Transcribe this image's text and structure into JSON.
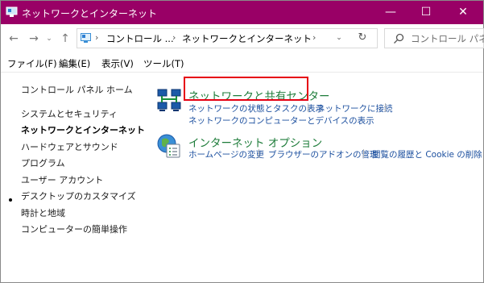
{
  "window": {
    "title": "ネットワークとインターネット",
    "buttons": {
      "minimize": "—",
      "maximize": "☐",
      "close": "✕"
    }
  },
  "nav": {
    "back": "←",
    "forward": "→",
    "up": "↑",
    "breadcrumb": [
      "コントロール ...",
      "ネットワークとインターネット"
    ],
    "separator": "›",
    "dropdown": "⌄",
    "refresh": "↻"
  },
  "search": {
    "placeholder": "コントロール パネル"
  },
  "menubar": [
    "ファイル(F)",
    "編集(E)",
    "表示(V)",
    "ツール(T)"
  ],
  "sidebar": {
    "items": [
      {
        "label": "コントロール パネル ホーム",
        "current": false
      },
      {
        "label": "システムとセキュリティ",
        "current": false
      },
      {
        "label": "ネットワークとインターネット",
        "current": true
      },
      {
        "label": "ハードウェアとサウンド",
        "current": false
      },
      {
        "label": "プログラム",
        "current": false
      },
      {
        "label": "ユーザー アカウント",
        "current": false
      },
      {
        "label": "デスクトップのカスタマイズ",
        "current": false
      },
      {
        "label": "時計と地域",
        "current": false
      },
      {
        "label": "コンピューターの簡単操作",
        "current": false
      }
    ]
  },
  "categories": [
    {
      "title": "ネットワークと共有センター",
      "icon": "network-sharing-center-icon",
      "links": [
        "ネットワークの状態とタスクの表示",
        "ネットワークに接続",
        "ネットワークのコンピューターとデバイスの表示"
      ],
      "highlighted": true
    },
    {
      "title": "インターネット オプション",
      "icon": "internet-options-icon",
      "links": [
        "ホームページの変更",
        "ブラウザーのアドオンの管理",
        "閲覧の履歴と Cookie の削除"
      ],
      "highlighted": false
    }
  ],
  "colors": {
    "titlebar": "#990066",
    "category_title": "#1e7c3a",
    "link": "#1a4e9e",
    "highlight_box": "#e60012"
  }
}
